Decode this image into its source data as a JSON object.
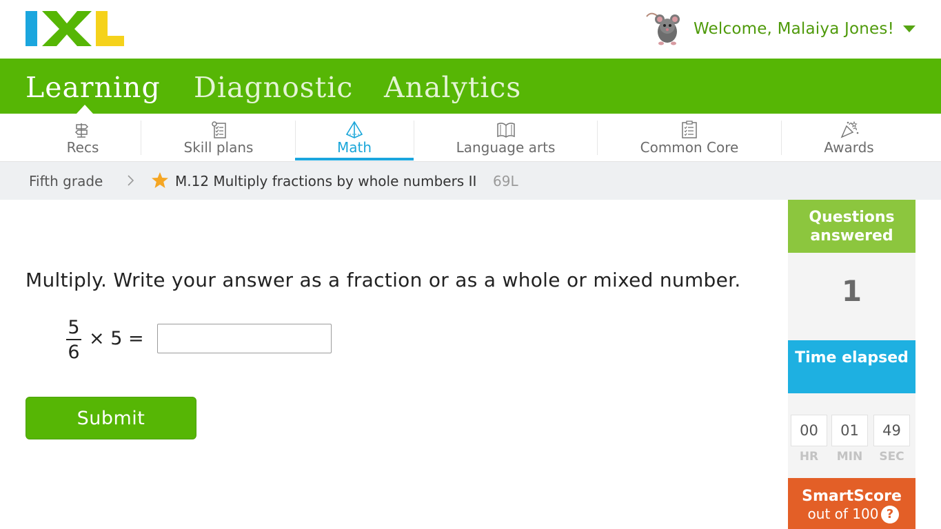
{
  "header": {
    "logo_text": "IXL",
    "welcome": "Welcome, Malaiya Jones!"
  },
  "main_nav": {
    "tabs": [
      {
        "label": "Learning",
        "active": true
      },
      {
        "label": "Diagnostic",
        "active": false
      },
      {
        "label": "Analytics",
        "active": false
      }
    ]
  },
  "subject_nav": {
    "tabs": [
      {
        "label": "Recs",
        "icon": "signpost-icon"
      },
      {
        "label": "Skill plans",
        "icon": "checklist-icon"
      },
      {
        "label": "Math",
        "icon": "pyramid-icon",
        "active": true
      },
      {
        "label": "Language arts",
        "icon": "book-icon"
      },
      {
        "label": "Common Core",
        "icon": "clipboard-icon"
      },
      {
        "label": "Awards",
        "icon": "party-popper-icon"
      }
    ]
  },
  "breadcrumb": {
    "grade": "Fifth grade",
    "skill": "M.12 Multiply fractions by whole numbers II",
    "code": "69L"
  },
  "question": {
    "prompt": "Multiply. Write your answer as a fraction or as a whole or mixed number.",
    "numerator": "5",
    "denominator": "6",
    "expression_rest": "× 5 =",
    "answer_value": "",
    "submit_label": "Submit"
  },
  "sidebar": {
    "questions_answered_label": "Questions answered",
    "questions_answered": "1",
    "time_elapsed_label": "Time elapsed",
    "time": {
      "hr": "00",
      "min": "01",
      "sec": "49"
    },
    "time_units": {
      "hr": "HR",
      "min": "MIN",
      "sec": "SEC"
    },
    "smartscore_label": "SmartScore",
    "smartscore_sub": "out of 100",
    "help_label": "?"
  },
  "colors": {
    "green": "#56b605",
    "blue": "#1eb0e1",
    "orange": "#e35f27",
    "lightgreen": "#8cc63e"
  }
}
